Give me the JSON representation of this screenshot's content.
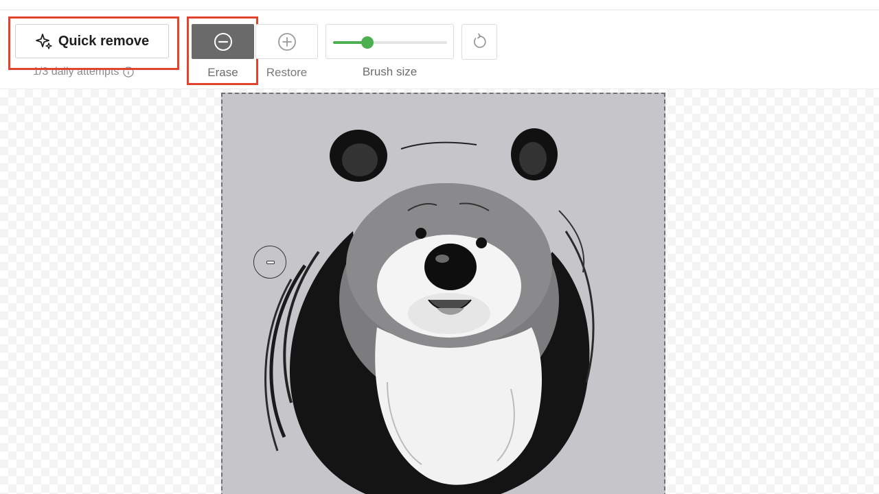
{
  "toolbar": {
    "quick_remove": {
      "label": "Quick remove",
      "icon": "sparkle-icon",
      "attempts_text": "1/3 daily attempts"
    },
    "erase": {
      "label": "Erase",
      "icon": "minus-circle-icon",
      "active": true
    },
    "restore": {
      "label": "Restore",
      "icon": "plus-circle-icon"
    },
    "brush": {
      "label": "Brush size",
      "level": 0.3
    },
    "reset": {
      "icon": "reset-icon"
    }
  },
  "colors": {
    "highlight": "#e2432e",
    "accent": "#4caf50",
    "active_tool_bg": "#6a6a6a",
    "image_bg": "#c6c5c9"
  }
}
